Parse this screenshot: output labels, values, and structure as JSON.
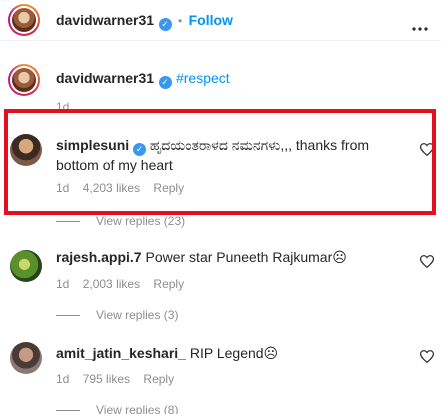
{
  "header": {
    "username": "davidwarner31",
    "separator": "•",
    "follow_label": "Follow",
    "more_icon": "ellipsis-icon"
  },
  "caption": {
    "username": "davidwarner31",
    "text": "#respect",
    "time": "1d"
  },
  "comments": [
    {
      "username": "simplesuni",
      "verified": true,
      "text": "ಹೃದಯಂತರಾಳದ ನಮನಗಳು,,, thanks from bottom of my heart",
      "time": "1d",
      "likes": "4,203 likes",
      "reply_label": "Reply",
      "view_replies": "View replies (23)"
    },
    {
      "username": "rajesh.appi.7",
      "text": "Power star Puneeth Rajkumar☹",
      "time": "1d",
      "likes": "2,003 likes",
      "reply_label": "Reply",
      "view_replies": "View replies (3)"
    },
    {
      "username": "amit_jatin_keshari_",
      "text": "RIP Legend☹",
      "time": "1d",
      "likes": "795 likes",
      "reply_label": "Reply",
      "view_replies": "View replies (8)"
    }
  ],
  "colors": {
    "accent": "#0095f6",
    "verified": "#3897f0",
    "highlight": "#e3101f",
    "muted": "#8e8e8e"
  }
}
